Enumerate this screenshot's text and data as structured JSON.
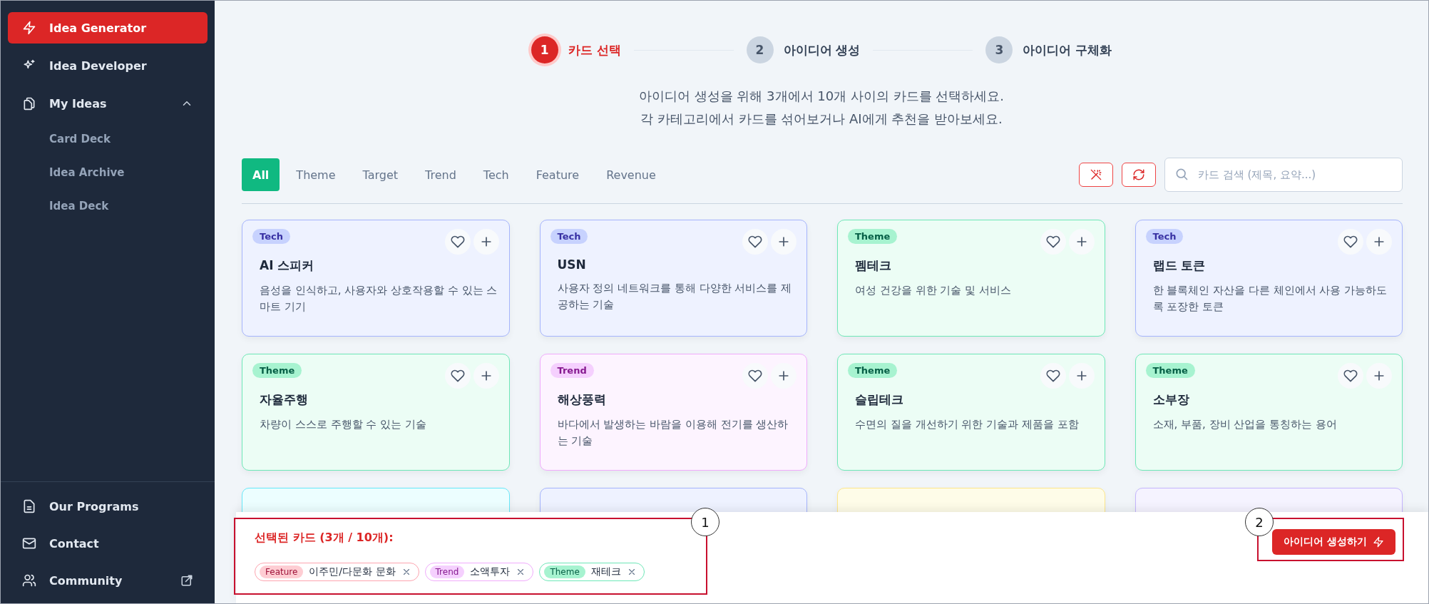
{
  "sidebar": {
    "items": [
      {
        "label": "Idea Generator",
        "selected": true
      },
      {
        "label": "Idea Developer",
        "selected": false
      },
      {
        "label": "My Ideas",
        "selected": false,
        "expanded": true,
        "children": [
          {
            "label": "Card Deck",
            "selected": false
          },
          {
            "label": "Idea Archive",
            "selected": false
          },
          {
            "label": "Idea Deck",
            "selected": false
          }
        ]
      }
    ],
    "footer_items": [
      {
        "label": "Our Programs",
        "external": false
      },
      {
        "label": "Contact",
        "external": false
      },
      {
        "label": "Community",
        "external": true
      }
    ]
  },
  "stepper": [
    {
      "number": "1",
      "label": "카드 선택",
      "active": true
    },
    {
      "number": "2",
      "label": "아이디어 생성",
      "active": false
    },
    {
      "number": "3",
      "label": "아이디어 구체화",
      "active": false
    }
  ],
  "description": [
    "아이디어 생성을 위해 3개에서 10개 사이의 카드를 선택하세요.",
    "각 카테고리에서 카드를 섞어보거나 AI에게 추천을 받아보세요."
  ],
  "filter_tabs": [
    {
      "label": "All",
      "selected": true
    },
    {
      "label": "Theme",
      "selected": false
    },
    {
      "label": "Target",
      "selected": false
    },
    {
      "label": "Trend",
      "selected": false
    },
    {
      "label": "Tech",
      "selected": false
    },
    {
      "label": "Feature",
      "selected": false
    },
    {
      "label": "Revenue",
      "selected": false
    }
  ],
  "search": {
    "placeholder": "카드 검색 (제목, 요약...)"
  },
  "cards": [
    {
      "kind": "tech",
      "category": "Tech",
      "title": "AI 스피커",
      "summary": "음성을 인식하고, 사용자와 상호작용할 수 있는 스마트 기기"
    },
    {
      "kind": "tech",
      "category": "Tech",
      "title": "USN",
      "summary": "사용자 정의 네트워크를 통해 다양한 서비스를 제공하는 기술"
    },
    {
      "kind": "theme",
      "category": "Theme",
      "title": "펨테크",
      "summary": "여성 건강을 위한 기술 및 서비스"
    },
    {
      "kind": "tech",
      "category": "Tech",
      "title": "랩드 토큰",
      "summary": "한 블록체인 자산을 다른 체인에서 사용 가능하도록 포장한 토큰"
    },
    {
      "kind": "theme",
      "category": "Theme",
      "title": "자율주행",
      "summary": "차량이 스스로 주행할 수 있는 기술"
    },
    {
      "kind": "trend",
      "category": "Trend",
      "title": "해상풍력",
      "summary": "바다에서 발생하는 바람을 이용해 전기를 생산하는 기술"
    },
    {
      "kind": "theme",
      "category": "Theme",
      "title": "슬립테크",
      "summary": "수면의 질을 개선하기 위한 기술과 제품을 포함"
    },
    {
      "kind": "theme",
      "category": "Theme",
      "title": "소부장",
      "summary": "소재, 부품, 장비 산업을 통칭하는 용어"
    },
    {
      "kind": "target"
    },
    {
      "kind": "tech"
    },
    {
      "kind": "revenue"
    },
    {
      "kind": "feature"
    }
  ],
  "selection": {
    "title": "선택된 카드 (3개 / 10개):",
    "chips": [
      {
        "kind": "feature",
        "category": "Feature",
        "label": "이주민/다문화 문화"
      },
      {
        "kind": "trend",
        "category": "Trend",
        "label": "소액투자"
      },
      {
        "kind": "theme",
        "category": "Theme",
        "label": "재테크"
      }
    ],
    "generate_button": "아이디어 생성하기"
  },
  "annotations": [
    {
      "label": "1"
    },
    {
      "label": "2"
    }
  ]
}
